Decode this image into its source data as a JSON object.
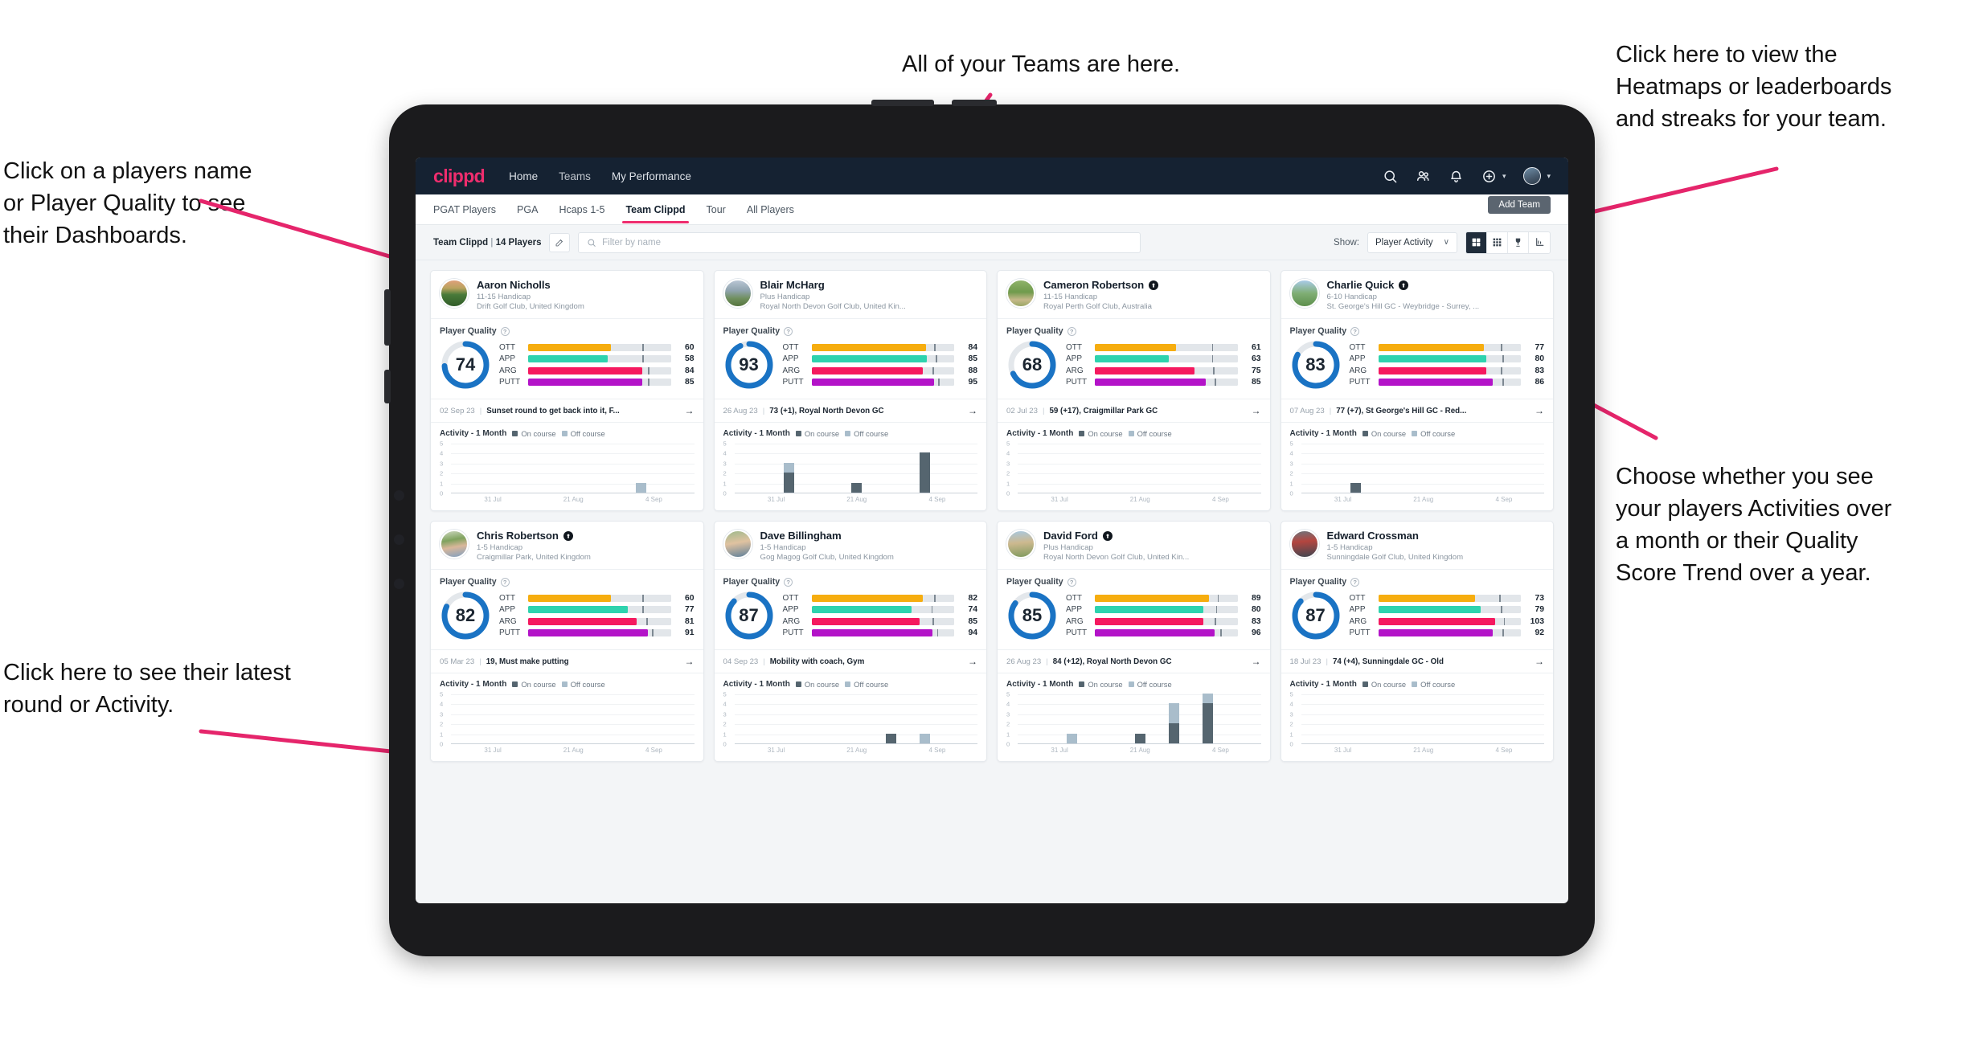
{
  "annotations": {
    "top_center": "All of your Teams are here.",
    "top_right": "Click here to view the\nHeatmaps or leaderboards\nand streaks for your team.",
    "left_top": "Click on a players name\nor Player Quality to see\ntheir Dashboards.",
    "right_mid": "Choose whether you see\nyour players Activities over\na month or their Quality\nScore Trend over a year.",
    "left_bottom": "Click here to see their latest\nround or Activity."
  },
  "topbar": {
    "logo": "clippd",
    "links": [
      "Home",
      "Teams",
      "My Performance"
    ],
    "icons": [
      "search-icon",
      "people-icon",
      "bell-icon",
      "plus-circle-icon",
      "avatar"
    ]
  },
  "subnav": {
    "tabs": [
      "PGAT Players",
      "PGA",
      "Hcaps 1-5",
      "Team Clippd",
      "Tour",
      "All Players"
    ],
    "active": "Team Clippd",
    "add_team_label": "Add Team"
  },
  "toolbar": {
    "team_name": "Team Clippd",
    "team_count": "14 Players",
    "separator": "|",
    "search_placeholder": "Filter by name",
    "show_label": "Show:",
    "show_value": "Player Activity",
    "view_buttons": [
      "grid-large-icon",
      "grid-small-icon",
      "trophy-icon",
      "chart-icon"
    ],
    "active_view": "grid-large-icon"
  },
  "card_labels": {
    "player_quality": "Player Quality",
    "activity": "Activity - 1 Month",
    "legend_on": "On course",
    "legend_off": "Off course",
    "metrics": [
      "OTT",
      "APP",
      "ARG",
      "PUTT"
    ]
  },
  "chart_data": {
    "type": "bar",
    "title": "Activity - 1 Month",
    "ylabel": "",
    "xlabel": "",
    "ylim": [
      0,
      5
    ],
    "yticks": [
      0,
      1,
      2,
      3,
      4,
      5
    ],
    "xticks": [
      "31 Jul",
      "21 Aug",
      "4 Sep"
    ],
    "legend": [
      "On course",
      "Off course"
    ],
    "legend_colors": [
      "#55656f",
      "#a9bdcb"
    ],
    "panels": [
      {
        "player": "Aaron Nicholls",
        "on_course": [
          0,
          0,
          0,
          0,
          0,
          0,
          0
        ],
        "off_course": [
          0,
          0,
          0,
          0,
          0,
          1,
          0
        ]
      },
      {
        "player": "Blair McHarg",
        "on_course": [
          0,
          2,
          0,
          1,
          0,
          4,
          0
        ],
        "off_course": [
          0,
          1,
          0,
          0,
          0,
          0,
          0
        ]
      },
      {
        "player": "Cameron Robertson",
        "on_course": [
          0,
          0,
          0,
          0,
          0,
          0,
          0
        ],
        "off_course": [
          0,
          0,
          0,
          0,
          0,
          0,
          0
        ]
      },
      {
        "player": "Charlie Quick",
        "on_course": [
          0,
          1,
          0,
          0,
          0,
          0,
          0
        ],
        "off_course": [
          0,
          0,
          0,
          0,
          0,
          0,
          0
        ]
      },
      {
        "player": "Chris Robertson",
        "on_course": [
          0,
          0,
          0,
          0,
          0,
          0,
          0
        ],
        "off_course": [
          0,
          0,
          0,
          0,
          0,
          0,
          0
        ]
      },
      {
        "player": "Dave Billingham",
        "on_course": [
          0,
          0,
          0,
          0,
          1,
          0,
          0
        ],
        "off_course": [
          0,
          0,
          0,
          0,
          0,
          1,
          0
        ]
      },
      {
        "player": "David Ford",
        "on_course": [
          0,
          0,
          0,
          1,
          2,
          4,
          0
        ],
        "off_course": [
          0,
          1,
          0,
          0,
          2,
          1,
          0
        ]
      },
      {
        "player": "Edward Crossman",
        "on_course": [
          0,
          0,
          0,
          0,
          0,
          0,
          0
        ],
        "off_course": [
          0,
          0,
          0,
          0,
          0,
          0,
          0
        ]
      }
    ]
  },
  "players": [
    {
      "name": "Aaron Nicholls",
      "verified": false,
      "avatar_class": "av0",
      "handicap": "11-15 Handicap",
      "club": "Drift Golf Club, United Kingdom",
      "quality": 74,
      "metrics": [
        {
          "label": "OTT",
          "value": 60,
          "fill": 58,
          "mark": 80,
          "color": "#f6ad0f"
        },
        {
          "label": "APP",
          "value": 58,
          "fill": 56,
          "mark": 80,
          "color": "#2ed3ae"
        },
        {
          "label": "ARG",
          "value": 84,
          "fill": 80,
          "mark": 84,
          "color": "#f5195f"
        },
        {
          "label": "PUTT",
          "value": 85,
          "fill": 80,
          "mark": 84,
          "color": "#b313c8"
        }
      ],
      "round_date": "02 Sep 23",
      "round_text": "Sunset round to get back into it, F..."
    },
    {
      "name": "Blair McHarg",
      "verified": false,
      "avatar_class": "av1",
      "handicap": "Plus Handicap",
      "club": "Royal North Devon Golf Club, United Kin...",
      "quality": 93,
      "metrics": [
        {
          "label": "OTT",
          "value": 84,
          "fill": 80,
          "mark": 86,
          "color": "#f6ad0f"
        },
        {
          "label": "APP",
          "value": 85,
          "fill": 81,
          "mark": 87,
          "color": "#2ed3ae"
        },
        {
          "label": "ARG",
          "value": 88,
          "fill": 78,
          "mark": 85,
          "color": "#f5195f"
        },
        {
          "label": "PUTT",
          "value": 95,
          "fill": 86,
          "mark": 89,
          "color": "#b313c8"
        }
      ],
      "round_date": "26 Aug 23",
      "round_text": "73 (+1), Royal North Devon GC"
    },
    {
      "name": "Cameron Robertson",
      "verified": true,
      "avatar_class": "av2",
      "handicap": "11-15 Handicap",
      "club": "Royal Perth Golf Club, Australia",
      "quality": 68,
      "metrics": [
        {
          "label": "OTT",
          "value": 61,
          "fill": 57,
          "mark": 82,
          "color": "#f6ad0f"
        },
        {
          "label": "APP",
          "value": 63,
          "fill": 52,
          "mark": 82,
          "color": "#2ed3ae"
        },
        {
          "label": "ARG",
          "value": 75,
          "fill": 70,
          "mark": 83,
          "color": "#f5195f"
        },
        {
          "label": "PUTT",
          "value": 85,
          "fill": 78,
          "mark": 84,
          "color": "#b313c8"
        }
      ],
      "round_date": "02 Jul 23",
      "round_text": "59 (+17), Craigmillar Park GC"
    },
    {
      "name": "Charlie Quick",
      "verified": true,
      "avatar_class": "av3",
      "handicap": "6-10 Handicap",
      "club": "St. George's Hill GC - Weybridge - Surrey, ...",
      "quality": 83,
      "metrics": [
        {
          "label": "OTT",
          "value": 77,
          "fill": 74,
          "mark": 86,
          "color": "#f6ad0f"
        },
        {
          "label": "APP",
          "value": 80,
          "fill": 76,
          "mark": 87,
          "color": "#2ed3ae"
        },
        {
          "label": "ARG",
          "value": 83,
          "fill": 76,
          "mark": 86,
          "color": "#f5195f"
        },
        {
          "label": "PUTT",
          "value": 86,
          "fill": 80,
          "mark": 87,
          "color": "#b313c8"
        }
      ],
      "round_date": "07 Aug 23",
      "round_text": "77 (+7), St George's Hill GC - Red..."
    },
    {
      "name": "Chris Robertson",
      "verified": true,
      "avatar_class": "av4",
      "handicap": "1-5 Handicap",
      "club": "Craigmillar Park, United Kingdom",
      "quality": 82,
      "metrics": [
        {
          "label": "OTT",
          "value": 60,
          "fill": 58,
          "mark": 80,
          "color": "#f6ad0f"
        },
        {
          "label": "APP",
          "value": 77,
          "fill": 70,
          "mark": 80,
          "color": "#2ed3ae"
        },
        {
          "label": "ARG",
          "value": 81,
          "fill": 76,
          "mark": 83,
          "color": "#f5195f"
        },
        {
          "label": "PUTT",
          "value": 91,
          "fill": 84,
          "mark": 87,
          "color": "#b313c8"
        }
      ],
      "round_date": "05 Mar 23",
      "round_text": "19, Must make putting"
    },
    {
      "name": "Dave Billingham",
      "verified": false,
      "avatar_class": "av5",
      "handicap": "1-5 Handicap",
      "club": "Gog Magog Golf Club, United Kingdom",
      "quality": 87,
      "metrics": [
        {
          "label": "OTT",
          "value": 82,
          "fill": 78,
          "mark": 86,
          "color": "#f6ad0f"
        },
        {
          "label": "APP",
          "value": 74,
          "fill": 70,
          "mark": 84,
          "color": "#2ed3ae"
        },
        {
          "label": "ARG",
          "value": 85,
          "fill": 76,
          "mark": 85,
          "color": "#f5195f"
        },
        {
          "label": "PUTT",
          "value": 94,
          "fill": 85,
          "mark": 88,
          "color": "#b313c8"
        }
      ],
      "round_date": "04 Sep 23",
      "round_text": "Mobility with coach, Gym"
    },
    {
      "name": "David Ford",
      "verified": true,
      "avatar_class": "av6",
      "handicap": "Plus Handicap",
      "club": "Royal North Devon Golf Club, United Kin...",
      "quality": 85,
      "metrics": [
        {
          "label": "OTT",
          "value": 89,
          "fill": 80,
          "mark": 86,
          "color": "#f6ad0f"
        },
        {
          "label": "APP",
          "value": 80,
          "fill": 76,
          "mark": 85,
          "color": "#2ed3ae"
        },
        {
          "label": "ARG",
          "value": 83,
          "fill": 76,
          "mark": 84,
          "color": "#f5195f"
        },
        {
          "label": "PUTT",
          "value": 96,
          "fill": 84,
          "mark": 88,
          "color": "#b313c8"
        }
      ],
      "round_date": "26 Aug 23",
      "round_text": "84 (+12), Royal North Devon GC"
    },
    {
      "name": "Edward Crossman",
      "verified": false,
      "avatar_class": "av7",
      "handicap": "1-5 Handicap",
      "club": "Sunningdale Golf Club, United Kingdom",
      "quality": 87,
      "metrics": [
        {
          "label": "OTT",
          "value": 73,
          "fill": 68,
          "mark": 85,
          "color": "#f6ad0f"
        },
        {
          "label": "APP",
          "value": 79,
          "fill": 72,
          "mark": 86,
          "color": "#2ed3ae"
        },
        {
          "label": "ARG",
          "value": 103,
          "fill": 82,
          "mark": 88,
          "color": "#f5195f"
        },
        {
          "label": "PUTT",
          "value": 92,
          "fill": 80,
          "mark": 87,
          "color": "#b313c8"
        }
      ],
      "round_date": "18 Jul 23",
      "round_text": "74 (+4), Sunningdale GC - Old"
    }
  ],
  "colors": {
    "accent_pink": "#ef2d6e",
    "navy": "#152232",
    "ring_blue": "#1a73c4",
    "annotation_arrow": "#e5256b"
  }
}
